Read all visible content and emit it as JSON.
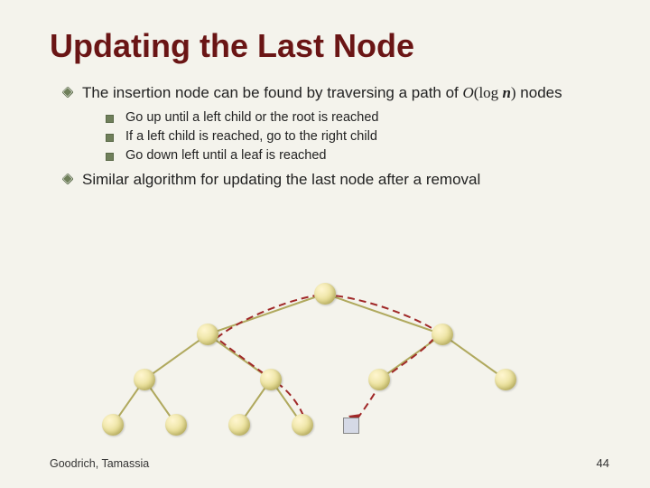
{
  "title": "Updating the Last Node",
  "bullets": {
    "b1_a": "The insertion node can be found by traversing a path of ",
    "b1_bO": "O",
    "b1_lp": "(",
    "b1_log": "log ",
    "b1_n": "n",
    "b1_rp": ")",
    "b1_c": " nodes",
    "b1_1": "Go up until a left child or the root is reached",
    "b1_2": "If a left child is reached, go to the right child",
    "b1_3": "Go down left until a leaf is reached",
    "b2": "Similar algorithm for updating the last node after a removal"
  },
  "footer": {
    "left": "Goodrich, Tamassia",
    "pageno": "44"
  }
}
